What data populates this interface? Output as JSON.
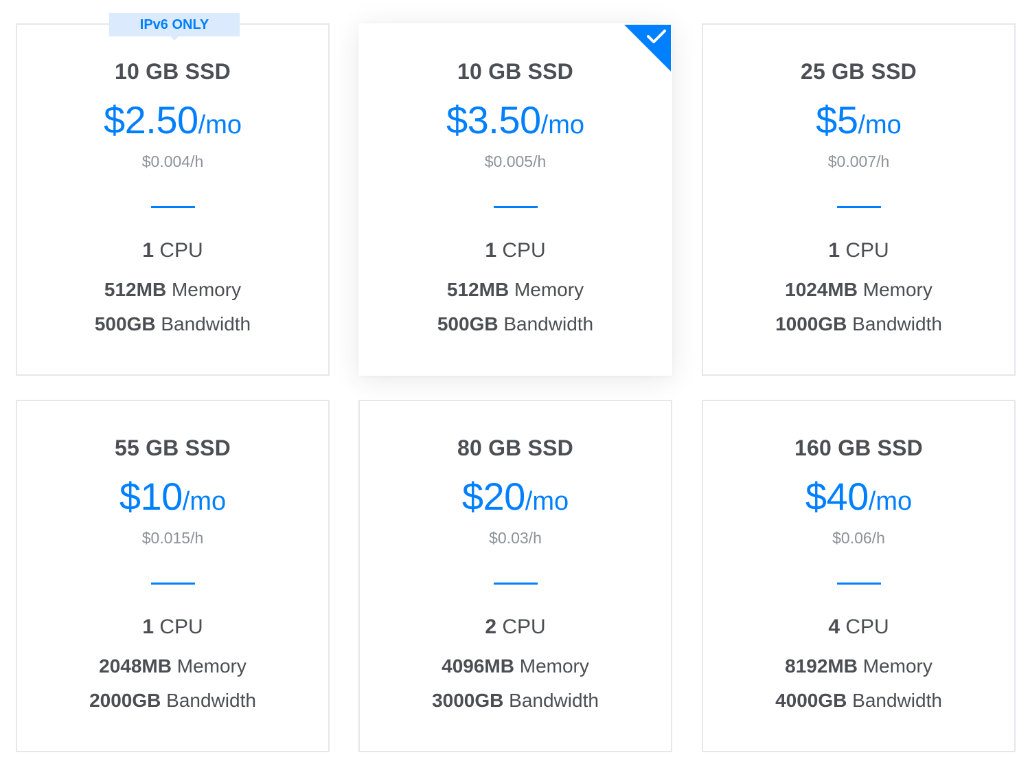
{
  "plans": [
    {
      "storage": "10 GB SSD",
      "price": "$2.50",
      "unit": "/mo",
      "hourly": "$0.004/h",
      "cpu_value": "1",
      "cpu_label": "CPU",
      "memory_value": "512MB",
      "memory_label": "Memory",
      "bandwidth_value": "500GB",
      "bandwidth_label": "Bandwidth",
      "badge": "IPv6 ONLY",
      "selected": false
    },
    {
      "storage": "10 GB SSD",
      "price": "$3.50",
      "unit": "/mo",
      "hourly": "$0.005/h",
      "cpu_value": "1",
      "cpu_label": "CPU",
      "memory_value": "512MB",
      "memory_label": "Memory",
      "bandwidth_value": "500GB",
      "bandwidth_label": "Bandwidth",
      "selected": true,
      "selected_icon": "check-icon"
    },
    {
      "storage": "25 GB SSD",
      "price": "$5",
      "unit": "/mo",
      "hourly": "$0.007/h",
      "cpu_value": "1",
      "cpu_label": "CPU",
      "memory_value": "1024MB",
      "memory_label": "Memory",
      "bandwidth_value": "1000GB",
      "bandwidth_label": "Bandwidth",
      "selected": false
    },
    {
      "storage": "55 GB SSD",
      "price": "$10",
      "unit": "/mo",
      "hourly": "$0.015/h",
      "cpu_value": "1",
      "cpu_label": "CPU",
      "memory_value": "2048MB",
      "memory_label": "Memory",
      "bandwidth_value": "2000GB",
      "bandwidth_label": "Bandwidth",
      "selected": false
    },
    {
      "storage": "80 GB SSD",
      "price": "$20",
      "unit": "/mo",
      "hourly": "$0.03/h",
      "cpu_value": "2",
      "cpu_label": "CPU",
      "memory_value": "4096MB",
      "memory_label": "Memory",
      "bandwidth_value": "3000GB",
      "bandwidth_label": "Bandwidth",
      "selected": false
    },
    {
      "storage": "160 GB SSD",
      "price": "$40",
      "unit": "/mo",
      "hourly": "$0.06/h",
      "cpu_value": "4",
      "cpu_label": "CPU",
      "memory_value": "8192MB",
      "memory_label": "Memory",
      "bandwidth_value": "4000GB",
      "bandwidth_label": "Bandwidth",
      "selected": false
    }
  ],
  "colors": {
    "accent": "#0080ff",
    "text": "#4b4e53",
    "muted": "#8d9199",
    "border": "#e5e7eb",
    "badge_bg": "#dbeafc"
  }
}
